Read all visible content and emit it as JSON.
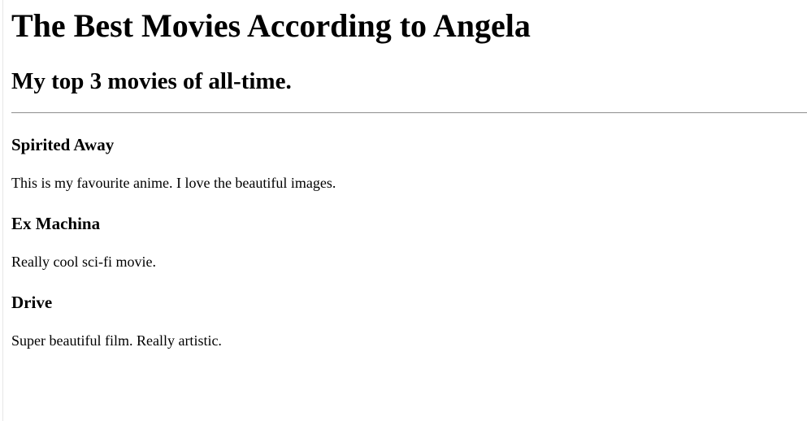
{
  "header": {
    "title": "The Best Movies According to Angela",
    "subtitle": "My top 3 movies of all-time."
  },
  "movies": [
    {
      "title": "Spirited Away",
      "description": "This is my favourite anime. I love the beautiful images."
    },
    {
      "title": "Ex Machina",
      "description": "Really cool sci-fi movie."
    },
    {
      "title": "Drive",
      "description": "Super beautiful film. Really artistic."
    }
  ]
}
